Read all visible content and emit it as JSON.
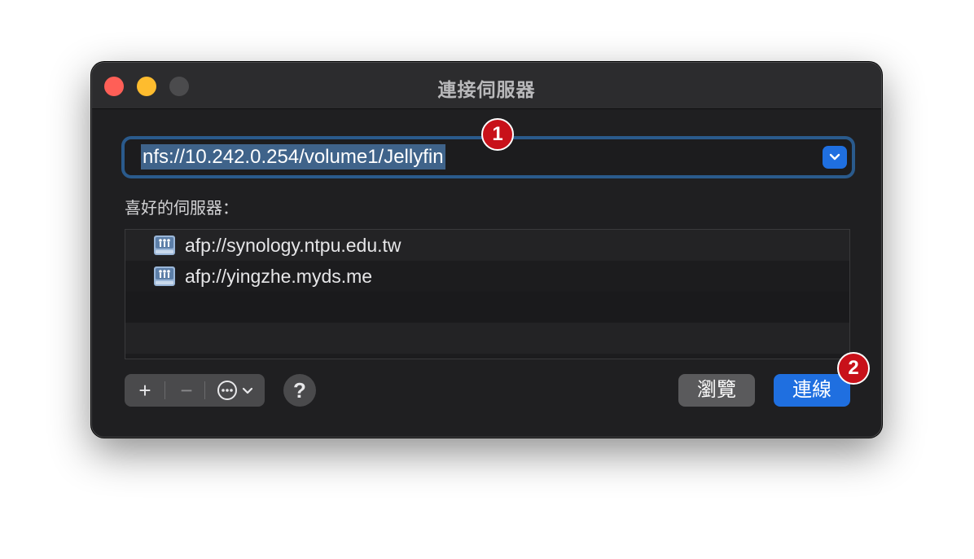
{
  "window": {
    "title": "連接伺服器"
  },
  "url_field": {
    "value": "nfs://10.242.0.254/volume1/Jellyfin"
  },
  "favorites": {
    "label": "喜好的伺服器：",
    "items": [
      {
        "label": "afp://synology.ntpu.edu.tw",
        "icon": "server-icon"
      },
      {
        "label": "afp://yingzhe.myds.me",
        "icon": "server-icon"
      }
    ]
  },
  "toolbar": {
    "add_label": "+",
    "remove_label": "−",
    "help_label": "?"
  },
  "buttons": {
    "browse_label": "瀏覽",
    "connect_label": "連線"
  },
  "annotations": {
    "badge_1": "1",
    "badge_2": "2"
  },
  "colors": {
    "accent": "#1f6fe0",
    "badge": "#c8111a",
    "close": "#ff5f57",
    "minimize": "#febc2e"
  }
}
